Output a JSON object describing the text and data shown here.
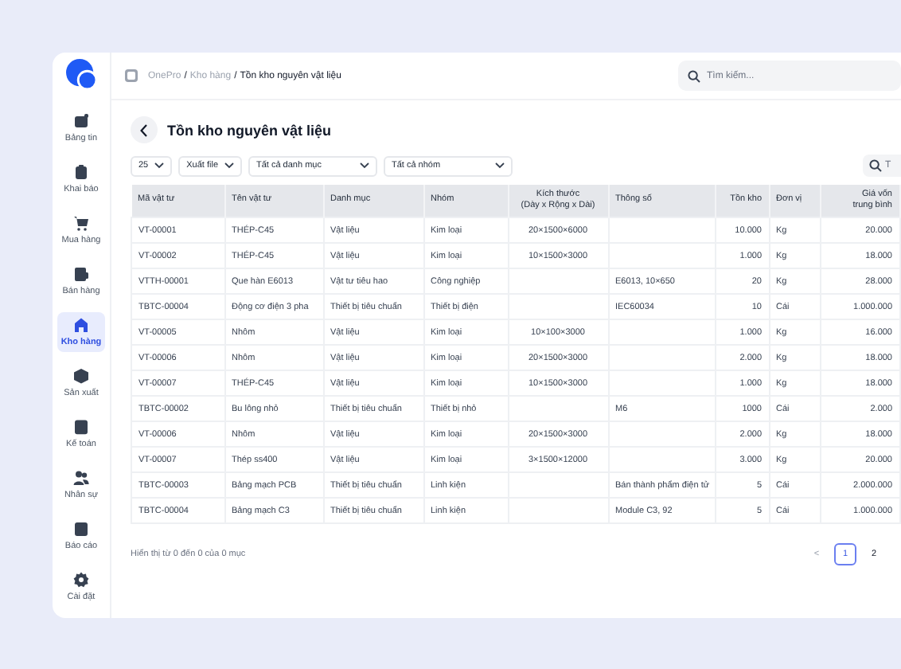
{
  "sidebar": {
    "items": [
      {
        "label": "Bảng tin",
        "selected": false
      },
      {
        "label": "Khai báo",
        "selected": false
      },
      {
        "label": "Mua hàng",
        "selected": false
      },
      {
        "label": "Bán hàng",
        "selected": false
      },
      {
        "label": "Kho hàng",
        "selected": true
      },
      {
        "label": "Sản xuất",
        "selected": false
      },
      {
        "label": "Kế toán",
        "selected": false
      },
      {
        "label": "Nhân sự",
        "selected": false
      },
      {
        "label": "Báo cáo",
        "selected": false
      },
      {
        "label": "Cài đặt",
        "selected": false
      }
    ]
  },
  "breadcrumb": {
    "separator": "/",
    "items": [
      {
        "label": "OnePro",
        "current": false
      },
      {
        "label": "Kho hàng",
        "current": false
      },
      {
        "label": "Tồn kho nguyên vật liệu",
        "current": true
      }
    ]
  },
  "search": {
    "placeholder": "Tìm kiếm..."
  },
  "page_title": "Tồn kho nguyên vật liệu",
  "toolbar": {
    "filters": [
      "25",
      "Xuất file",
      "Tất cả danh mục",
      "Tất cả nhóm"
    ],
    "search_placeholder": "T"
  },
  "table": {
    "columns": [
      "Mã vật tư",
      "Tên vật tư",
      "Danh mục",
      "Nhóm",
      "Kích thước\n(Dày x Rộng x Dài)",
      "Thông số",
      "Tồn kho",
      "Đơn vị",
      "Giá vốn\ntrung bình"
    ],
    "rows": [
      [
        "VT-00001",
        "THÉP-C45",
        "Vật liệu",
        "Kim loại",
        "20×1500×6000",
        "",
        "10.000",
        "Kg",
        "20.000"
      ],
      [
        "VT-00002",
        "THÉP-C45",
        "Vật liệu",
        "Kim loại",
        "10×1500×3000",
        "",
        "1.000",
        "Kg",
        "18.000"
      ],
      [
        "VTTH-00001",
        "Que hàn E6013",
        "Vật tư tiêu hao",
        "Công nghiệp",
        "",
        "E6013, 10×650",
        "20",
        "Kg",
        "28.000"
      ],
      [
        "TBTC-00004",
        "Động cơ điện 3 pha",
        "Thiết bị tiêu chuẩn",
        "Thiết bị điện",
        "",
        "IEC60034",
        "10",
        "Cái",
        "1.000.000"
      ],
      [
        "VT-00005",
        "Nhôm",
        "Vật liệu",
        "Kim loại",
        "10×100×3000",
        "",
        "1.000",
        "Kg",
        "16.000"
      ],
      [
        "VT-00006",
        "Nhôm",
        "Vật liệu",
        "Kim loại",
        "20×1500×3000",
        "",
        "2.000",
        "Kg",
        "18.000"
      ],
      [
        "VT-00007",
        "THÉP-C45",
        "Vật liệu",
        "Kim loại",
        "10×1500×3000",
        "",
        "1.000",
        "Kg",
        "18.000"
      ],
      [
        "TBTC-00002",
        "Bu lông nhỏ",
        "Thiết bị tiêu chuẩn",
        "Thiết bị nhỏ",
        "",
        "M6",
        "1000",
        "Cái",
        "2.000"
      ],
      [
        "VT-00006",
        "Nhôm",
        "Vật liệu",
        "Kim loại",
        "20×1500×3000",
        "",
        "2.000",
        "Kg",
        "18.000"
      ],
      [
        "VT-00007",
        "Thép ss400",
        "Vật liệu",
        "Kim loại",
        "3×1500×12000",
        "",
        "3.000",
        "Kg",
        "20.000"
      ],
      [
        "TBTC-00003",
        "Bảng mạch PCB",
        "Thiết bị tiêu chuẩn",
        "Linh kiện",
        "",
        "Bán thành phẩm điện tử",
        "5",
        "Cái",
        "2.000.000"
      ],
      [
        "TBTC-00004",
        "Bảng mạch C3",
        "Thiết bị tiêu chuẩn",
        "Linh kiện",
        "",
        "Module C3, 92",
        "5",
        "Cái",
        "1.000.000"
      ]
    ]
  },
  "footer": {
    "summary": "Hiển thị từ 0 đến 0 của 0 mục",
    "prev": {
      "label": "<",
      "disabled": true
    },
    "pages": [
      {
        "label": "1",
        "selected": true
      },
      {
        "label": "2",
        "selected": false
      }
    ]
  }
}
